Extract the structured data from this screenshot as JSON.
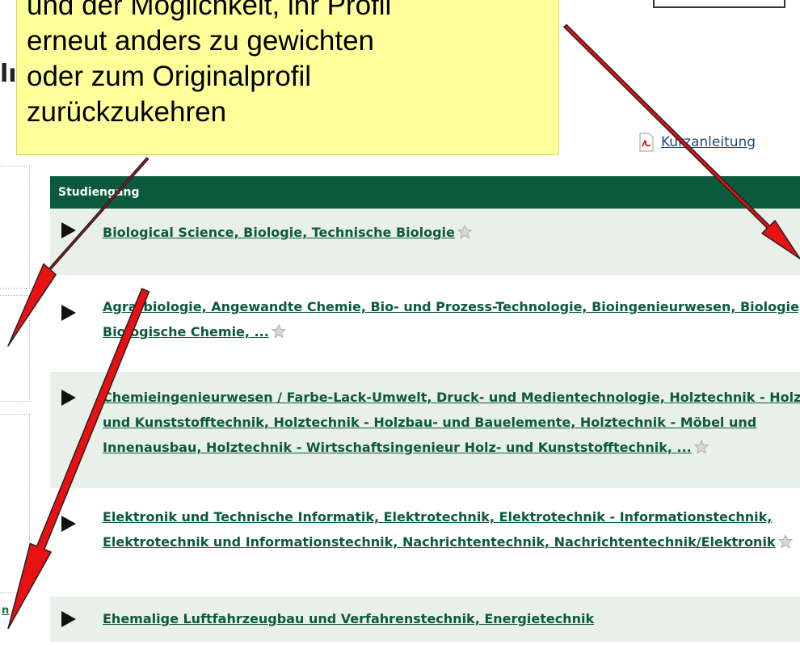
{
  "page": {
    "heading_fragment": "lı"
  },
  "callout": {
    "text": "und der Möglichkeit, ihr Profil\nerneut anders zu gewichten\noder zum Originalprofil\nzurückzukehren"
  },
  "pdf_link": {
    "label": "Kurzanleitung",
    "icon": "pdf-icon"
  },
  "left_panel": {
    "link_fragment": "n"
  },
  "results": {
    "header": "Studiengang",
    "rows": [
      {
        "text": "Biological Science, Biologie, Technische Biologie"
      },
      {
        "text": "Agrarbiologie, Angewandte Chemie, Bio- und Prozess-Technologie, Bioingenieurwesen, Biologie, Biologische Chemie, ..."
      },
      {
        "text": "Chemieingenieurwesen / Farbe-Lack-Umwelt, Druck- und Medientechnologie, Holztechnik - Holz und Kunststofftechnik, Holztechnik - Holzbau- und Bauelemente, Holztechnik - Möbel und Innenausbau, Holztechnik - Wirtschaftsingenieur Holz- und Kunststofftechnik, ..."
      },
      {
        "text": "Elektronik und Technische Informatik, Elektrotechnik, Elektrotechnik - Informationstechnik, Elektrotechnik und Informationstechnik, Nachrichtentechnik, Nachrichtentechnik/Elektronik"
      },
      {
        "text": "Ehemalige Luftfahrzeugbau und Verfahrenstechnik, Energietechnik"
      }
    ]
  },
  "colors": {
    "header_bg": "#0b5a3e",
    "link": "#0b5a3e",
    "callout_bg": "#ffff99",
    "arrow": "#e81010"
  },
  "annotations": {
    "arrows": [
      "arrow-to-kurzanleitung",
      "arrow-to-left-panel",
      "arrow-to-left-link"
    ]
  }
}
